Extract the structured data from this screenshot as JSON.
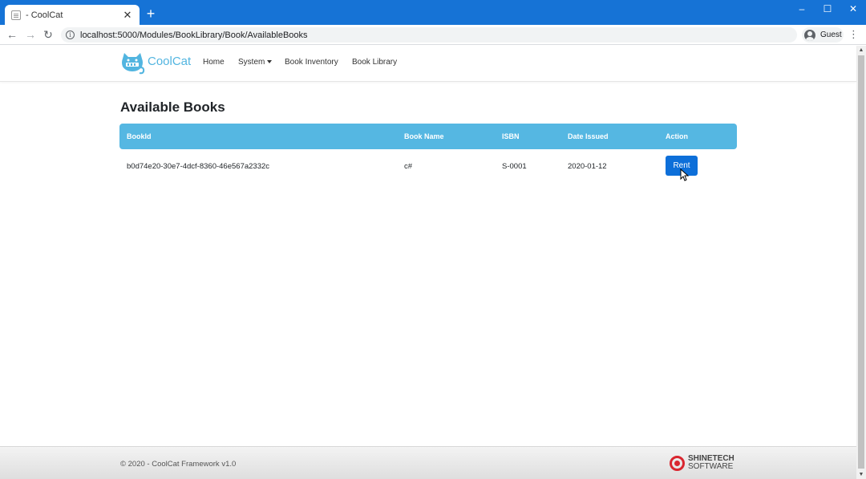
{
  "browser": {
    "tab_title": "- CoolCat",
    "tab_close": "✕",
    "new_tab": "+",
    "url": "localhost:5000/Modules/BookLibrary/Book/AvailableBooks",
    "profile_label": "Guest",
    "menu_glyph": "⋮",
    "minimize": "–",
    "maximize": "☐",
    "close": "✕",
    "back": "←",
    "forward": "→",
    "reload": "↻",
    "info_glyph": "i"
  },
  "navbar": {
    "brand": "CoolCat",
    "links": [
      "Home",
      "System",
      "Book Inventory",
      "Book Library"
    ]
  },
  "main": {
    "title": "Available Books",
    "columns": [
      "BookId",
      "Book Name",
      "ISBN",
      "Date Issued",
      "Action"
    ],
    "rows": [
      {
        "book_id": "b0d74e20-30e7-4dcf-8360-46e567a2332c",
        "book_name": "c#",
        "isbn": "S-0001",
        "date_issued": "2020-01-12",
        "action": "Rent"
      }
    ]
  },
  "footer": {
    "copyright": "© 2020 - CoolCat Framework v1.0",
    "company_line1": "SHINETECH",
    "company_line2": "SOFTWARE"
  },
  "colors": {
    "browser_tabbar": "#1673d6",
    "brand": "#52b5e0",
    "table_header": "#55b7e2",
    "rent_button": "#0d6fd9",
    "logo_red": "#d9262f"
  }
}
